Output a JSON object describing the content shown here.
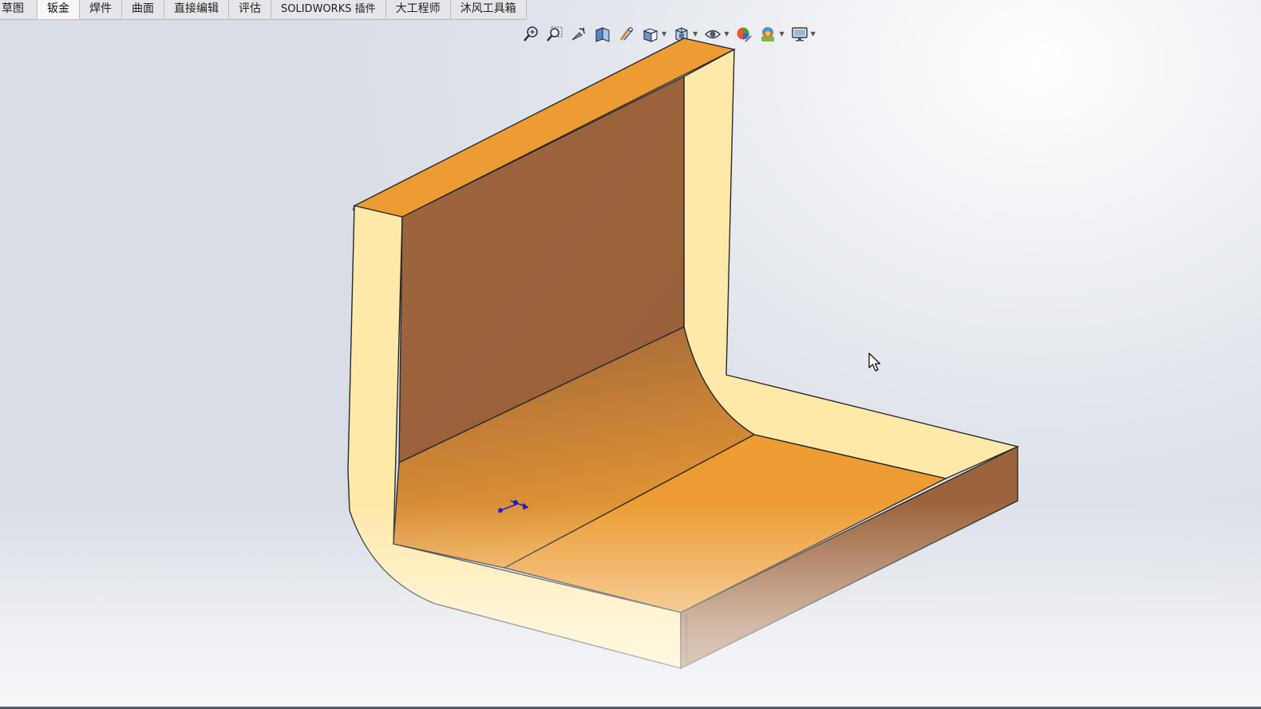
{
  "tabs": [
    {
      "label": "草图",
      "active": false
    },
    {
      "label": "钣金",
      "active": true
    },
    {
      "label": "焊件",
      "active": false
    },
    {
      "label": "曲面",
      "active": false
    },
    {
      "label": "直接编辑",
      "active": false
    },
    {
      "label": "评估",
      "active": false
    },
    {
      "label": "SOLIDWORKS 插件",
      "active": false
    },
    {
      "label": "大工程师",
      "active": false
    },
    {
      "label": "沐风工具箱",
      "active": false
    }
  ],
  "heads_up_toolbar": [
    {
      "icon": "zoom-to-fit-icon"
    },
    {
      "icon": "zoom-to-area-icon"
    },
    {
      "icon": "previous-view-icon"
    },
    {
      "icon": "section-view-icon"
    },
    {
      "icon": "dynamic-annotation-icon"
    },
    {
      "icon": "view-orientation-icon",
      "dropdown": true
    },
    {
      "icon": "display-style-icon",
      "dropdown": true
    },
    {
      "icon": "hide-show-items-icon",
      "dropdown": true
    },
    {
      "icon": "edit-appearance-icon"
    },
    {
      "icon": "apply-scene-icon",
      "dropdown": true
    },
    {
      "icon": "view-settings-icon",
      "dropdown": true
    }
  ],
  "colors": {
    "top_face": "#ec9c32",
    "edge_face": "#ffe9a8",
    "inner_wall": "#9c643c",
    "outline": "#2a2a2a",
    "triad_blue": "#1a1ad0"
  }
}
